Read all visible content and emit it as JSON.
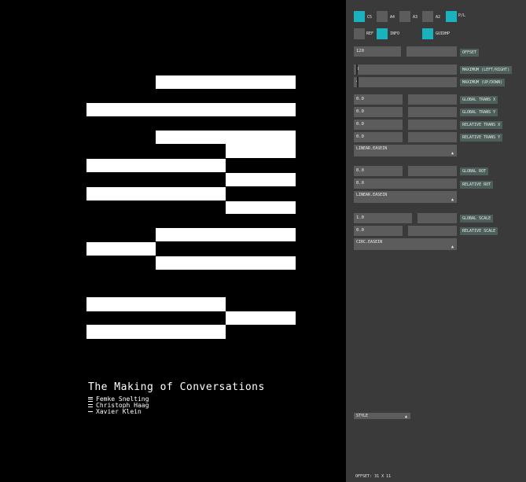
{
  "poster": {
    "title": "The Making of Conversations",
    "authors": [
      "Femke Snelting",
      "Christoph Haag",
      "Xavier Klein"
    ]
  },
  "panel": {
    "formats": [
      {
        "label": "C5",
        "active": true
      },
      {
        "label": "A4",
        "active": false
      },
      {
        "label": "A3",
        "active": false
      },
      {
        "label": "A2",
        "active": false
      },
      {
        "label": "P/L",
        "active": true
      }
    ],
    "toggles": [
      {
        "label": "REF",
        "active": false
      },
      {
        "label": "INFO",
        "active": true
      },
      {
        "label": "GUIDHP",
        "active": true
      }
    ],
    "offset": {
      "value": "120",
      "label": "OFFSET"
    },
    "maximum_lr": {
      "value": "3",
      "label": "MAXIMUM (LEFT/RIGHT)"
    },
    "maximum_ud": {
      "value": "4",
      "label": "MAXIMUM (UP/DOWN)"
    },
    "global_trans_x": {
      "value": "0.0",
      "label": "GLOBAL TRANS X"
    },
    "global_trans_y": {
      "value": "0.0",
      "label": "GLOBAL TRANS Y"
    },
    "relative_trans_x": {
      "value": "0.0",
      "label": "RELATIVE TRANS X"
    },
    "relative_trans_y": {
      "value": "0.0",
      "label": "RELATIVE TRANS Y"
    },
    "easing_trans": "LINEAR.EASEIN",
    "global_rot": {
      "value": "0.0",
      "label": "GLOBAL ROT"
    },
    "relative_rot": {
      "value": "0.0",
      "label": "RELATIVE ROT"
    },
    "easing_rot": "LINEAR.EASEIN",
    "global_scale": {
      "value": "1.0",
      "label": "GLOBAL SCALE"
    },
    "relative_scale": {
      "value": "0.0",
      "label": "RELATIVE SCALE"
    },
    "easing_scale": "CIRC.EASEIN",
    "style": "STYLE",
    "status": "OFFSET: 31 X 11"
  },
  "colors": {
    "accent": "#1ab2bf",
    "control": "#5c5c5c",
    "panel": "#3a3a3a",
    "label_bg": "#4c5f5a"
  }
}
